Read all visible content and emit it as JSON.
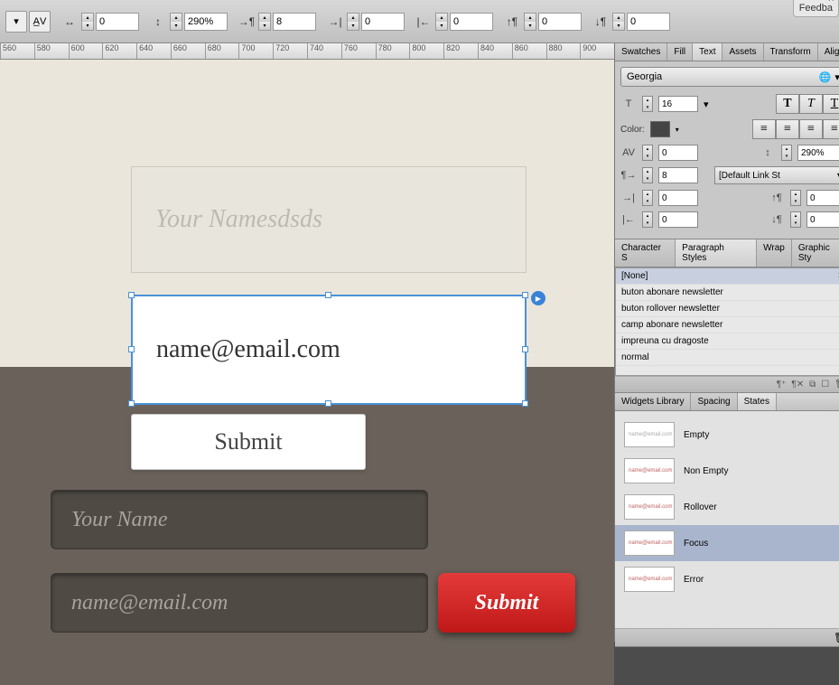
{
  "feedback_label": "Feedba",
  "toolbar": {
    "tracking": "0",
    "leading": "290%",
    "indent1": "8",
    "indent2": "0",
    "indent3": "0",
    "indent4": "0",
    "space_before": "0",
    "space_after": "0"
  },
  "ruler_marks": [
    "560",
    "580",
    "600",
    "620",
    "640",
    "660",
    "680",
    "700",
    "720",
    "740",
    "760",
    "780",
    "800",
    "820",
    "840",
    "860",
    "880",
    "900"
  ],
  "canvas": {
    "field_name": "Your Namesdsds",
    "field_email": "name@email.com",
    "btn_submit": "Submit",
    "dark_name": "Your Name",
    "dark_email": "name@email.com",
    "dark_submit": "Submit"
  },
  "text_panel": {
    "tabs": [
      "Swatches",
      "Fill",
      "Text",
      "Assets",
      "Transform",
      "Align"
    ],
    "active_tab": "Text",
    "font": "Georgia",
    "size": "16",
    "color_label": "Color:",
    "tracking": "0",
    "leading": "290%",
    "para_indent": "8",
    "link_style": "[Default Link St",
    "left_indent": "0",
    "sp_before": "0",
    "right_indent": "0",
    "sp_after": "0"
  },
  "styles_panel": {
    "tabs": [
      "Character S",
      "Paragraph Styles",
      "Wrap",
      "Graphic Sty"
    ],
    "active_tab": "Paragraph Styles",
    "items": [
      "[None]",
      "buton abonare newsletter",
      "buton rollover newsletter",
      "camp abonare newsletter",
      "impreuna cu dragoste",
      "normal"
    ]
  },
  "states_panel": {
    "tabs": [
      "Widgets Library",
      "Spacing",
      "States"
    ],
    "active_tab": "States",
    "thumb_text": "name@email.com",
    "states": [
      "Empty",
      "Non Empty",
      "Rollover",
      "Focus",
      "Error"
    ],
    "active_state": "Focus"
  }
}
